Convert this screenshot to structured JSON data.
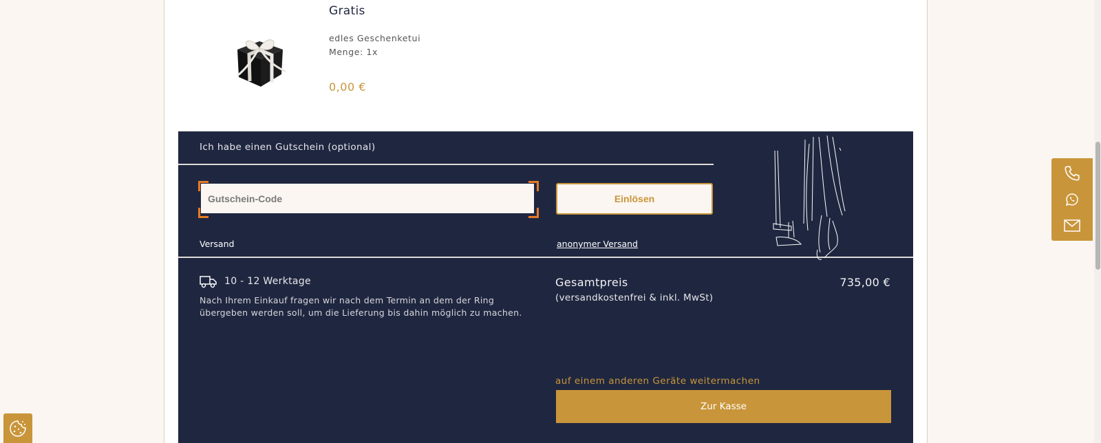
{
  "product": {
    "title": "Gratis",
    "description": "edles Geschenketui",
    "quantity": "Menge: 1x",
    "price": "0,00 €",
    "image_icon": "gift-box-icon"
  },
  "voucher": {
    "label": "Ich habe einen Gutschein (optional)",
    "placeholder": "Gutschein-Code",
    "value": "",
    "redeem_label": "Einlösen"
  },
  "shipping": {
    "label": "Versand",
    "anonymous_link": "anonymer Versand",
    "delivery_time": "10 - 12 Werktage",
    "delivery_note": "Nach Ihrem Einkauf fragen wir nach dem Termin an dem der Ring übergeben werden soll, um die Lieferung bis dahin möglich zu machen."
  },
  "summary": {
    "total_label": "Gesamtpreis",
    "total_sub": "(versandkostenfrei & inkl. MwSt)",
    "total_price": "735,00 €",
    "continue_link": "auf einem anderen Geräte weitermachen",
    "checkout_label": "Zur Kasse"
  },
  "contact": {
    "icons": [
      "phone-icon",
      "whatsapp-icon",
      "mail-icon"
    ]
  },
  "colors": {
    "navy": "#1f2740",
    "gold": "#c9953a",
    "cream": "#fbf6f1",
    "focus": "#e67a25"
  }
}
